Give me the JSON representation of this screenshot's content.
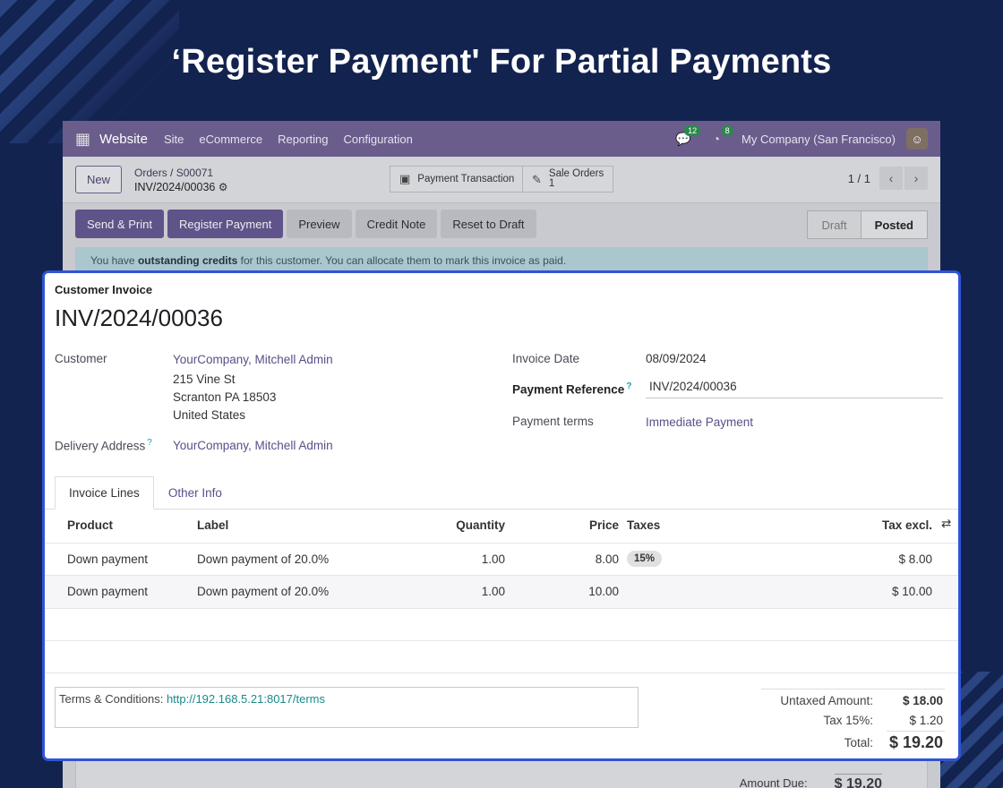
{
  "headline": "‘Register Payment' For Partial Payments",
  "navbar": {
    "app_name": "Website",
    "menus": [
      "Site",
      "eCommerce",
      "Reporting",
      "Configuration"
    ],
    "messages_badge": "12",
    "activities_badge": "8",
    "company": "My Company (San Francisco)"
  },
  "control": {
    "new_label": "New",
    "breadcrumb_root": "Orders",
    "breadcrumb_sep": "/",
    "breadcrumb_order": "S00071",
    "record_name": "INV/2024/00036",
    "payment_transaction_label": "Payment Transaction",
    "sale_orders_label": "Sale Orders",
    "sale_orders_count": "1",
    "pager": "1 / 1"
  },
  "actions": {
    "send_print": "Send & Print",
    "register_payment": "Register Payment",
    "preview": "Preview",
    "credit_note": "Credit Note",
    "reset_to_draft": "Reset to Draft",
    "status_draft": "Draft",
    "status_posted": "Posted"
  },
  "alert": {
    "prefix": "You have ",
    "bold": "outstanding credits",
    "suffix": " for this customer. You can allocate them to mark this invoice as paid."
  },
  "invoice": {
    "type": "Customer Invoice",
    "number": "INV/2024/00036",
    "customer_label": "Customer",
    "customer_name": "YourCompany, Mitchell Admin",
    "address_line1": "215 Vine St",
    "address_line2": "Scranton PA 18503",
    "address_line3": "United States",
    "delivery_label": "Delivery Address",
    "delivery_value": "YourCompany, Mitchell Admin",
    "invoice_date_label": "Invoice Date",
    "invoice_date": "08/09/2024",
    "payment_reference_label": "Payment Reference",
    "payment_reference": "INV/2024/00036",
    "payment_terms_label": "Payment terms",
    "payment_terms": "Immediate Payment",
    "help_mark": "?"
  },
  "tabs": [
    "Invoice Lines",
    "Other Info"
  ],
  "table": {
    "headers": {
      "product": "Product",
      "label": "Label",
      "quantity": "Quantity",
      "price": "Price",
      "taxes": "Taxes",
      "tax_excl": "Tax excl."
    },
    "rows": [
      {
        "product": "Down payment",
        "label": "Down payment of 20.0%",
        "quantity": "1.00",
        "price": "8.00",
        "tax": "15%",
        "tax_excl": "$ 8.00"
      },
      {
        "product": "Down payment",
        "label": "Down payment of 20.0%",
        "quantity": "1.00",
        "price": "10.00",
        "tax": "",
        "tax_excl": "$ 10.00"
      }
    ]
  },
  "terms": {
    "label": "Terms & Conditions: ",
    "link": "http://192.168.5.21:8017/terms"
  },
  "totals": {
    "untaxed_label": "Untaxed Amount:",
    "untaxed_value": "$ 18.00",
    "tax_label": "Tax 15%:",
    "tax_value": "$ 1.20",
    "total_label": "Total:",
    "total_value": "$ 19.20",
    "amount_due_label": "Amount Due:",
    "amount_due_value": "$ 19.20"
  }
}
